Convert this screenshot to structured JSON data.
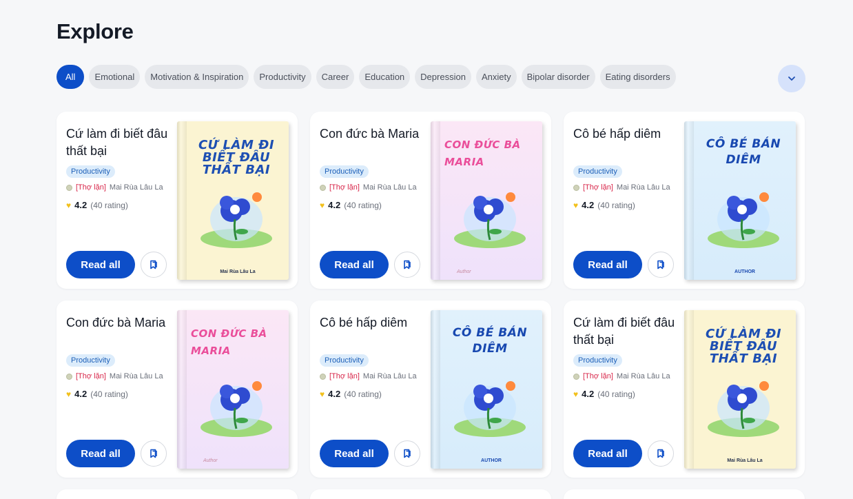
{
  "page": {
    "title": "Explore"
  },
  "filters": {
    "chips": [
      "All",
      "Emotional",
      "Motivation & Inspiration",
      "Productivity",
      "Career",
      "Education",
      "Depression",
      "Anxiety",
      "Bipolar disorder",
      "Eating disorders"
    ],
    "active": "All",
    "expand_icon": "chevron-down-icon"
  },
  "books": [
    {
      "title": "Cứ làm đi biết đâu thất bại",
      "tag": "Productivity",
      "rank": "[Thợ lặn]",
      "author": "Mai Rùa Lâu La",
      "rating": "4.2",
      "rating_count": "(40 rating)",
      "read_label": "Read all",
      "cover_title": "CỨ LÀM ĐI BIẾT ĐÂU THẤT BẠI",
      "cover_author": "Mai Rùa Lâu La",
      "cover_style": "yellow"
    },
    {
      "title": "Con đức bà Maria",
      "tag": "Productivity",
      "rank": "[Thợ lặn]",
      "author": "Mai Rùa Lâu La",
      "rating": "4.2",
      "rating_count": "(40 rating)",
      "read_label": "Read all",
      "cover_title": "CON ĐỨC BÀ MARIA",
      "cover_author": "Author",
      "cover_style": "pink"
    },
    {
      "title": "Cô bé hấp diêm",
      "tag": "Productivity",
      "rank": "[Thợ lặn]",
      "author": "Mai Rùa Lâu La",
      "rating": "4.2",
      "rating_count": "(40 rating)",
      "read_label": "Read all",
      "cover_title": "CÔ BÉ BÁN DIÊM",
      "cover_author": "AUTHOR",
      "cover_style": "blue"
    },
    {
      "title": "Con đức bà Maria",
      "tag": "Productivity",
      "rank": "[Thợ lặn]",
      "author": "Mai Rùa Lâu La",
      "rating": "4.2",
      "rating_count": "(40 rating)",
      "read_label": "Read all",
      "cover_title": "CON ĐỨC BÀ MARIA",
      "cover_author": "Author",
      "cover_style": "pink"
    },
    {
      "title": "Cô bé hấp diêm",
      "tag": "Productivity",
      "rank": "[Thợ lặn]",
      "author": "Mai Rùa Lâu La",
      "rating": "4.2",
      "rating_count": "(40 rating)",
      "read_label": "Read all",
      "cover_title": "CÔ BÉ BÁN DIÊM",
      "cover_author": "AUTHOR",
      "cover_style": "blue"
    },
    {
      "title": "Cứ làm đi biết đâu thất bại",
      "tag": "Productivity",
      "rank": "[Thợ lặn]",
      "author": "Mai Rùa Lâu La",
      "rating": "4.2",
      "rating_count": "(40 rating)",
      "read_label": "Read all",
      "cover_title": "CỨ LÀM ĐI BIẾT ĐÂU THẤT BẠI",
      "cover_author": "Mai Rùa Lâu La",
      "cover_style": "yellow"
    }
  ],
  "colors": {
    "accent": "#0d4ec8",
    "chip_bg": "#e6e8ec",
    "tag_bg": "#dcecfb",
    "rank": "#d8264a",
    "star": "#f2c01c"
  },
  "icons": {
    "rating": "heart-icon",
    "save": "bookmark-icon",
    "avatar": "avatar-dot-icon"
  }
}
